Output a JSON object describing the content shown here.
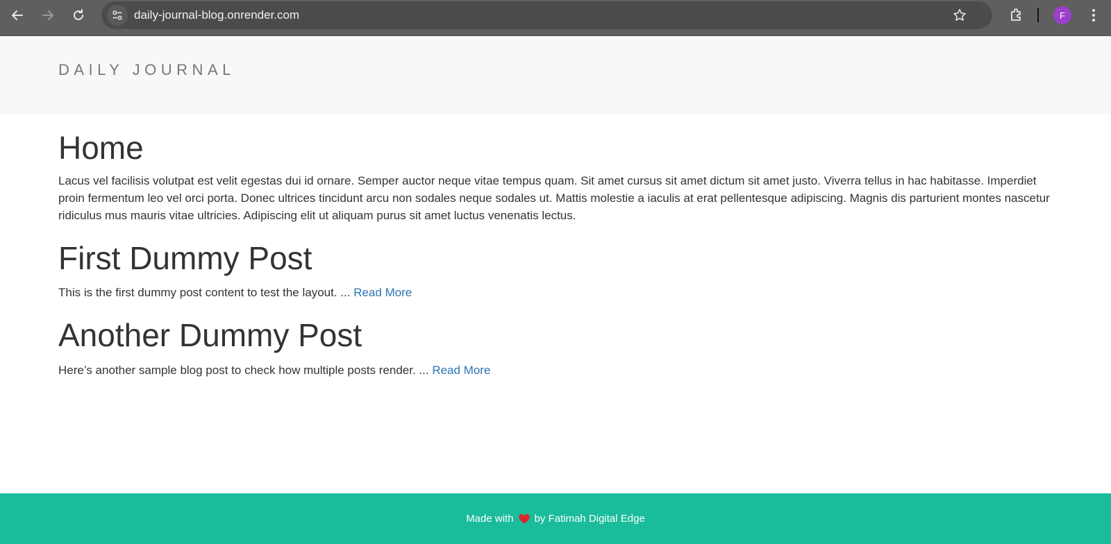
{
  "browser": {
    "url": "daily-journal-blog.onrender.com",
    "avatar_letter": "F",
    "icons": [
      "back-arrow-icon",
      "forward-arrow-icon",
      "reload-icon",
      "site-info-icon",
      "star-icon",
      "extensions-icon",
      "kebab-menu-icon"
    ]
  },
  "header": {
    "brand": "DAILY JOURNAL"
  },
  "home": {
    "title": "Home",
    "text": "Lacus vel facilisis volutpat est velit egestas dui id ornare. Semper auctor neque vitae tempus quam. Sit amet cursus sit amet dictum sit amet justo. Viverra tellus in hac habitasse. Imperdiet proin fermentum leo vel orci porta. Donec ultrices tincidunt arcu non sodales neque sodales ut. Mattis molestie a iaculis at erat pellentesque adipiscing. Magnis dis parturient montes nascetur ridiculus mus mauris vitae ultricies. Adipiscing elit ut aliquam purus sit amet luctus venenatis lectus."
  },
  "posts": [
    {
      "title": "First Dummy Post",
      "excerpt": "This is the first dummy post content to test the layout. ...",
      "read_more": "Read More"
    },
    {
      "title": "Another Dummy Post",
      "excerpt": "Here’s another sample blog post to check how multiple posts render. ...",
      "read_more": "Read More"
    }
  ],
  "footer": {
    "made_with": "Made with",
    "by": "by Fatimah Digital Edge",
    "heart_color": "#e0262b"
  },
  "colors": {
    "footer_bg": "#1abc9c",
    "link": "#2f74b5",
    "header_bg": "#f8f8f8"
  }
}
